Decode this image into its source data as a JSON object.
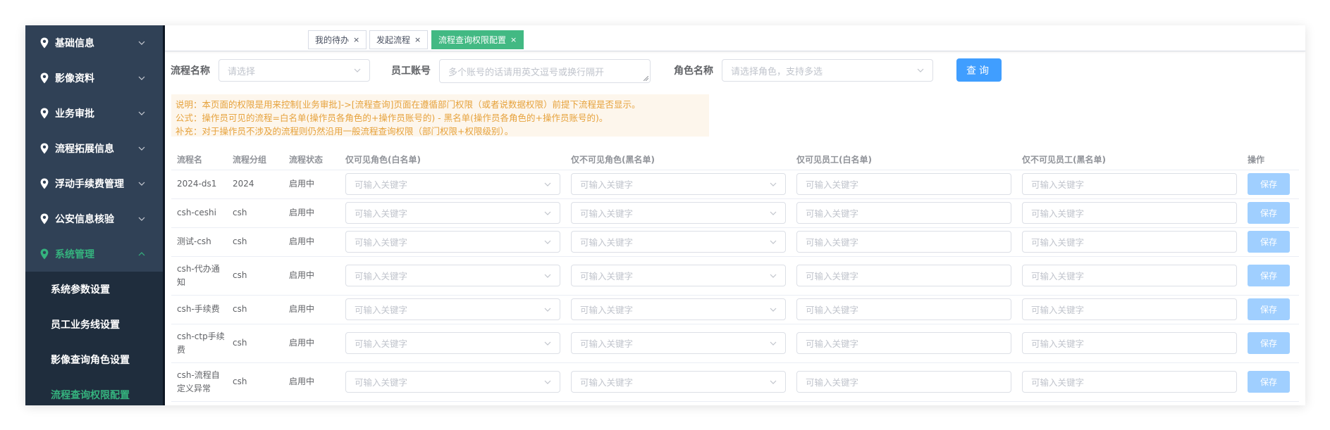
{
  "sidebar": {
    "items": [
      {
        "label": "基础信息",
        "icon": "location-pin-icon"
      },
      {
        "label": "影像资料",
        "icon": "location-pin-icon"
      },
      {
        "label": "业务审批",
        "icon": "location-pin-icon"
      },
      {
        "label": "流程拓展信息",
        "icon": "location-pin-icon"
      },
      {
        "label": "浮动手续费管理",
        "icon": "location-pin-icon"
      },
      {
        "label": "公安信息核验",
        "icon": "location-pin-icon"
      },
      {
        "label": "系统管理",
        "icon": "location-pin-icon",
        "expanded": true,
        "active": true
      }
    ],
    "subitems": [
      {
        "label": "系统参数设置"
      },
      {
        "label": "员工业务线设置"
      },
      {
        "label": "影像查询角色设置"
      },
      {
        "label": "流程查询权限配置",
        "active": true
      }
    ]
  },
  "tags": [
    {
      "label": "我的待办",
      "close": "×"
    },
    {
      "label": "发起流程",
      "close": "×"
    },
    {
      "label": "流程查询权限配置",
      "close": "×",
      "active": true
    }
  ],
  "search": {
    "flow_name_label": "流程名称",
    "flow_name_placeholder": "请选择",
    "employee_label": "员工账号",
    "employee_placeholder": "多个账号的话请用英文逗号或换行隔开",
    "role_label": "角色名称",
    "role_placeholder": "请选择角色，支持多选",
    "query_button": "查询"
  },
  "notice": {
    "line1": "说明：本页面的权限是用来控制[业务审批]->[流程查询]页面在遵循部门权限（或者说数据权限）前提下流程是否显示。",
    "line2": "公式：操作员可见的流程=白名单(操作员各角色的+操作员账号的) - 黑名单(操作员各角色的+操作员账号的)。",
    "line3": "补充：对于操作员不涉及的流程则仍然沿用一般流程查询权限（部门权限+权限级别）。"
  },
  "table": {
    "headers": {
      "name": "流程名",
      "group": "流程分组",
      "status": "流程状态",
      "visible_roles": "仅可见角色(白名单)",
      "invisible_roles": "仅不可见角色(黑名单)",
      "visible_staff": "仅可见员工(白名单)",
      "invisible_staff": "仅不可见员工(黑名单)",
      "action": "操作"
    },
    "placeholder": "可输入关键字",
    "save_label": "保存",
    "rows": [
      {
        "name1": "2024-ds1",
        "name2": "",
        "group": "2024",
        "status": "启用中"
      },
      {
        "name1": "csh-ceshi",
        "name2": "",
        "group": "csh",
        "status": "启用中"
      },
      {
        "name1": "测试-csh",
        "name2": "",
        "group": "csh",
        "status": "启用中"
      },
      {
        "name1": "csh-代办通",
        "name2": "知",
        "group": "csh",
        "status": "启用中"
      },
      {
        "name1": "csh-手续费",
        "name2": "",
        "group": "csh",
        "status": "启用中"
      },
      {
        "name1": "csh-ctp手续",
        "name2": "费",
        "group": "csh",
        "status": "启用中"
      },
      {
        "name1": "csh-流程自",
        "name2": "定义异常",
        "group": "csh",
        "status": "启用中"
      }
    ]
  }
}
